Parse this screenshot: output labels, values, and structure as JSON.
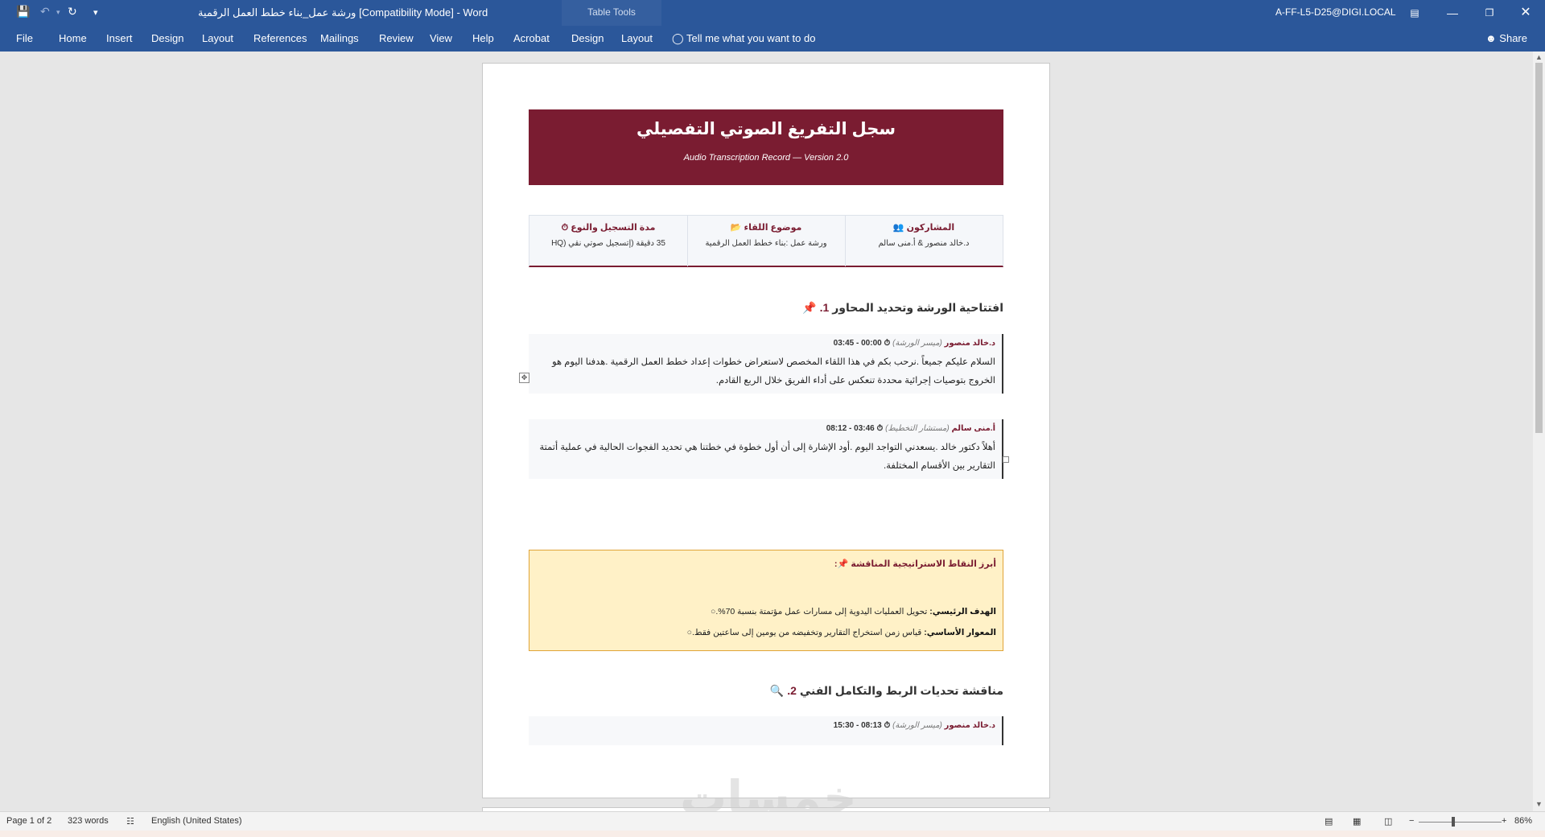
{
  "window": {
    "title": "ورشة عمل_بناء خطط العمل الرقمية [Compatibility Mode] - Word",
    "contextual_group": "Table Tools",
    "account": "A-FF-L5-D25@DIGI.LOCAL",
    "share": "Share"
  },
  "ribbon": {
    "tabs": [
      "File",
      "Home",
      "Insert",
      "Design",
      "Layout",
      "References",
      "Mailings",
      "Review",
      "View",
      "Help",
      "Acrobat",
      "Design",
      "Layout"
    ],
    "tell_me": "Tell me what you want to do"
  },
  "doc": {
    "header": {
      "title": "سجل التفريغ الصوتي التفصيلي",
      "subtitle": "Audio Transcription Record — Version 2.0"
    },
    "info": [
      {
        "label": "المشاركون 👥",
        "value": "د.خالد منصور & أ.منى سالم"
      },
      {
        "label": "موضوع اللقاء 📂",
        "value": "ورشة عمل :بناء خطط العمل الرقمية"
      },
      {
        "label": "مدة التسجيل والنوع ⏱",
        "value": "35 دقيقة (إتسجيل صوتي نقي (HQ"
      }
    ],
    "section1": {
      "num": "1.",
      "title": "افتتاحية الورشة وتحديد المحاور",
      "icon": "📌"
    },
    "entries": [
      {
        "speaker": "د.خالد منصور",
        "role": "(ميسر الورشة)",
        "time": "⏱ 00:00 - 03:45",
        "text": "السلام عليكم جميعاً .نرحب بكم في هذا اللقاء المخصص لاستعراض خطوات إعداد خطط العمل الرقمية .هدفنا اليوم هو الخروج بتوصيات إجرائية محددة تنعكس على أداء الفريق خلال الربع القادم."
      },
      {
        "speaker": "أ.منى سالم",
        "role": "(مستشار التخطيط)",
        "time": "⏱ 03:46 - 08:12",
        "text": "أهلاً دكتور خالد .يسعدني التواجد اليوم .أود الإشارة إلى أن أول خطوة في خطتنا هي تحديد الفجوات الحالية في عملية أتمتة التقارير بين الأقسام المختلفة."
      },
      {
        "speaker": "د.خالد منصور",
        "role": "(ميسر الورشة)",
        "time": "⏱ 08:13 - 15:30",
        "text": ""
      }
    ],
    "points": {
      "title": "أبرز النقاط الاستراتيجية المناقشة 📌:",
      "items": [
        {
          "label": "الهدف الرئيسي:",
          "text": " تحويل العمليات اليدوية إلى مسارات عمل مؤتمتة بنسبة 70%."
        },
        {
          "label": "المعوار الأساسي:",
          "text": " قياس زمن استخراج التقارير وتخفيضه من يومين إلى ساعتين فقط."
        }
      ]
    },
    "section2": {
      "num": "2.",
      "title": "مناقشة تحديات الربط والتكامل الفني",
      "icon": "🔍"
    },
    "watermark": "خمسات"
  },
  "status": {
    "page": "Page 1 of 2",
    "words": "323 words",
    "language": "English (United States)",
    "zoom": "86%"
  }
}
